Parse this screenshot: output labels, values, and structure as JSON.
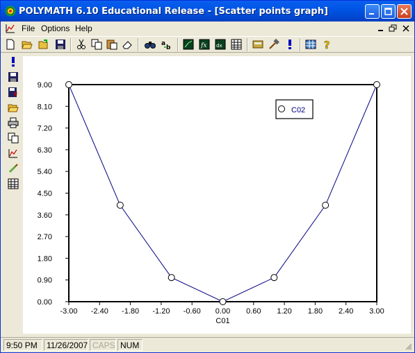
{
  "window": {
    "title": "POLYMATH 6.10 Educational Release - [Scatter points graph]"
  },
  "menu": {
    "items": [
      "File",
      "Options",
      "Help"
    ]
  },
  "toolbar": {
    "icons": [
      "new-icon",
      "open-icon",
      "open-green-icon",
      "save-icon",
      "cut-icon",
      "copy-icon",
      "paste-icon",
      "eraser-icon",
      "find-icon",
      "replace-icon",
      "graph-icon",
      "function-icon",
      "matrix-icon",
      "table-icon",
      "calculator-icon",
      "hammer-icon",
      "run-icon",
      "units-icon",
      "help-icon"
    ]
  },
  "sidebar": {
    "icons": [
      "run-icon",
      "save-icon",
      "save-as-icon",
      "open-icon",
      "print-icon",
      "copy-icon",
      "graph-settings-icon",
      "brush-icon",
      "table-icon"
    ]
  },
  "chart_data": {
    "type": "scatter",
    "x": [
      -3,
      -2,
      -1,
      0,
      1,
      2,
      3
    ],
    "y": [
      9,
      4,
      1,
      0,
      1,
      4,
      9
    ],
    "series": [
      {
        "name": "C02",
        "x": [
          -3,
          -2,
          -1,
          0,
          1,
          2,
          3
        ],
        "y": [
          9,
          4,
          1,
          0,
          1,
          4,
          9
        ]
      }
    ],
    "xlabel": "C01",
    "ylabel": "",
    "xlim": [
      -3,
      3
    ],
    "ylim": [
      0,
      9
    ],
    "xticks": [
      "-3.00",
      "-2.40",
      "-1.80",
      "-1.20",
      "-0.60",
      "0.00",
      "0.60",
      "1.20",
      "1.80",
      "2.40",
      "3.00"
    ],
    "yticks": [
      "0.00",
      "0.90",
      "1.80",
      "2.70",
      "3.60",
      "4.50",
      "5.40",
      "6.30",
      "7.20",
      "8.10",
      "9.00"
    ],
    "legend": "top-right",
    "grid": false,
    "connected": true,
    "line_color": "#000080",
    "marker": "open-circle"
  },
  "status": {
    "time": "9:50 PM",
    "date": "11/26/2007",
    "caps": "CAPS",
    "num": "NUM"
  }
}
